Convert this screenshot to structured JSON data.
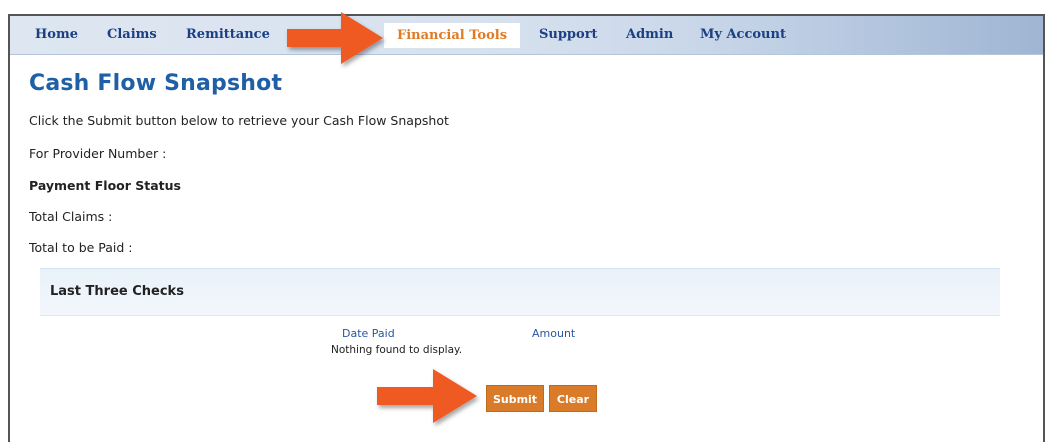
{
  "nav": {
    "items": [
      {
        "label": "Home",
        "active": false
      },
      {
        "label": "Claims",
        "active": false
      },
      {
        "label": "Remittance",
        "active": false
      },
      {
        "label": "Financial Tools",
        "active": true
      },
      {
        "label": "Support",
        "active": false
      },
      {
        "label": "Admin",
        "active": false
      },
      {
        "label": "My Account",
        "active": false
      }
    ]
  },
  "page": {
    "title": "Cash Flow Snapshot",
    "instruction": "Click the Submit button below to retrieve your Cash Flow Snapshot",
    "provider_label": "For Provider Number :",
    "payment_floor_heading": "Payment Floor Status",
    "total_claims_label": "Total Claims :",
    "total_paid_label": "Total to be Paid :"
  },
  "checks": {
    "heading": "Last Three Checks",
    "columns": [
      "Date Paid",
      "Amount"
    ],
    "empty_message": "Nothing found to display."
  },
  "buttons": {
    "submit_label": "Submit",
    "clear_label": "Clear"
  },
  "colors": {
    "accent_orange": "#d97b28",
    "arrow_orange": "#ef5a24",
    "title_blue": "#1f5fa6",
    "nav_blue": "#1a3f82"
  },
  "icons": [
    "pointer-arrow-icon"
  ]
}
